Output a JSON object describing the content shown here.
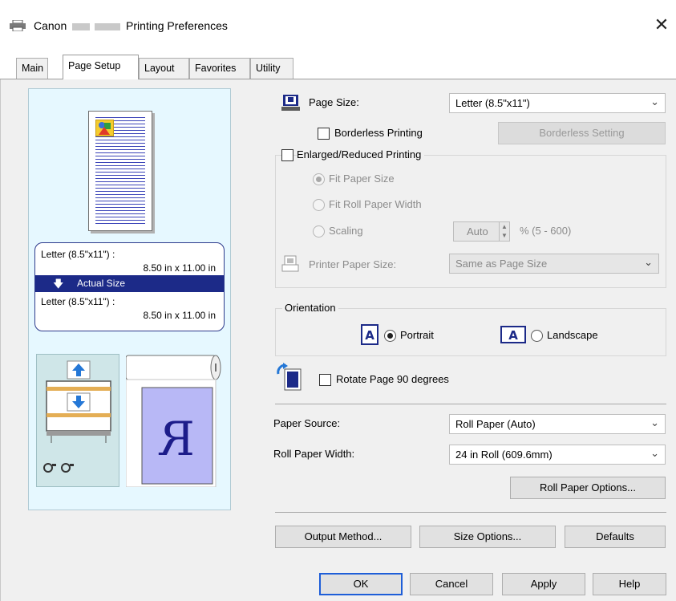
{
  "window": {
    "title_prefix": "Canon",
    "title_suffix": "Printing Preferences",
    "close_glyph": "✕"
  },
  "tabs": [
    {
      "label": "Main",
      "active": false
    },
    {
      "label": "Page Setup",
      "active": true
    },
    {
      "label": "Layout",
      "active": false
    },
    {
      "label": "Favorites",
      "active": false
    },
    {
      "label": "Utility",
      "active": false
    }
  ],
  "preview": {
    "size_line1": "Letter (8.5\"x11\") :",
    "size_line2": "8.50 in x 11.00 in",
    "actual_size": "Actual Size",
    "size_line3": "Letter (8.5\"x11\") :",
    "size_line4": "8.50 in x 11.00 in"
  },
  "page_size": {
    "label": "Page Size:",
    "value": "Letter (8.5\"x11\")"
  },
  "borderless": {
    "checkbox_label": "Borderless Printing",
    "checked": false,
    "settings_button": "Borderless Setting"
  },
  "enlarged": {
    "checkbox_label": "Enlarged/Reduced Printing",
    "checked": false,
    "options": [
      {
        "label": "Fit Paper Size",
        "selected": true
      },
      {
        "label": "Fit Roll Paper Width",
        "selected": false
      },
      {
        "label": "Scaling",
        "selected": false
      }
    ],
    "scaling_value": "Auto",
    "scaling_range": "% (5 - 600)",
    "printer_paper_size_label": "Printer Paper Size:",
    "printer_paper_size_value": "Same as Page Size"
  },
  "orientation": {
    "group_label": "Orientation",
    "portrait_label": "Portrait",
    "landscape_label": "Landscape",
    "selected": "Portrait"
  },
  "rotate": {
    "label": "Rotate Page 90 degrees",
    "checked": false
  },
  "paper_source": {
    "label": "Paper Source:",
    "value": "Roll Paper (Auto)"
  },
  "roll_width": {
    "label": "Roll Paper Width:",
    "value": "24 in Roll (609.6mm)"
  },
  "buttons": {
    "roll_paper_options": "Roll Paper Options...",
    "output_method": "Output Method...",
    "size_options": "Size Options...",
    "defaults": "Defaults",
    "ok": "OK",
    "cancel": "Cancel",
    "apply": "Apply",
    "help": "Help"
  },
  "colors": {
    "preview_bg": "#e6f8ff",
    "accent_navy": "#1c2a88",
    "default_button_border": "#1e5ed8"
  }
}
